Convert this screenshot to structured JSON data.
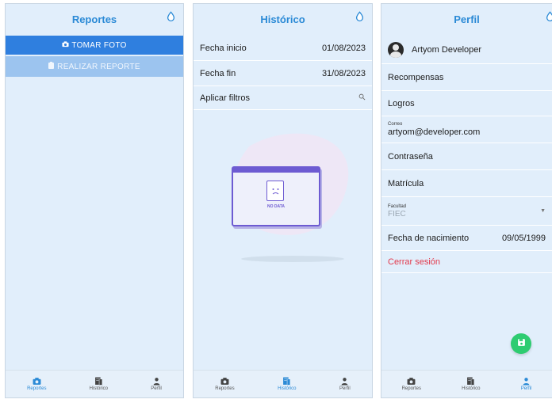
{
  "reportes": {
    "title": "Reportes",
    "take_photo": "TOMAR FOTO",
    "make_report": "REALIZAR REPORTE"
  },
  "historico": {
    "title": "Histórico",
    "start_label": "Fecha inicio",
    "start_value": "01/08/2023",
    "end_label": "Fecha fin",
    "end_value": "31/08/2023",
    "filters_label": "Aplicar filtros",
    "no_data": "NO DATA"
  },
  "perfil": {
    "title": "Perfil",
    "user_name": "Artyom Developer",
    "rewards": "Recompensas",
    "achievements": "Logros",
    "email_label": "Correo",
    "email_value": "artyom@developer.com",
    "password": "Contraseña",
    "enrollment": "Matrícula",
    "faculty_label": "Facultad",
    "faculty_value": "FIEC",
    "birth_label": "Fecha de nacimiento",
    "birth_value": "09/05/1999",
    "logout": "Cerrar sesión"
  },
  "nav": {
    "reportes": "Reportes",
    "historico": "Histórico",
    "perfil": "Perfil"
  },
  "colors": {
    "accent": "#2b8ad6",
    "primary_button": "#2f7fdf",
    "disabled_button": "#9cc4ef",
    "background": "#e1eefb",
    "logout": "#e23a4c",
    "fab": "#2ecc71"
  },
  "icons": [
    "water-drop-icon",
    "camera-icon",
    "clipboard-icon",
    "search-icon",
    "document-icon",
    "person-icon",
    "save-icon",
    "chevron-down-icon"
  ]
}
